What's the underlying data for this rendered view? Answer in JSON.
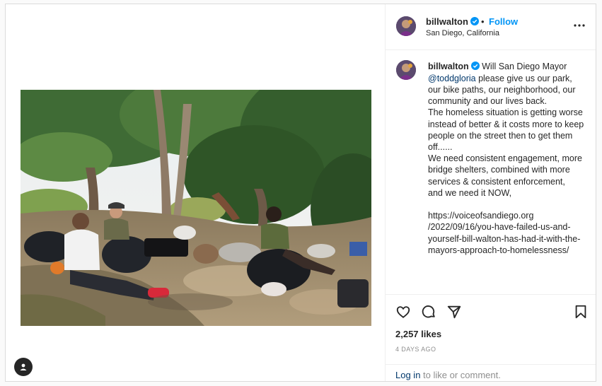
{
  "post": {
    "username": "billwalton",
    "location": "San Diego, California",
    "separator": "•",
    "follow_label": "Follow",
    "caption_username": "billwalton",
    "caption_prefix": " Will San Diego Mayor ",
    "caption_mention": "@toddgloria",
    "caption_body": " please give us our park, our bike paths, our neighborhood, our community and our lives back.\nThe homeless situation is getting worse instead of better & it costs more to keep people on the street then to get them off......\nWe need consistent engagement, more bridge shelters, combined with more services & consistent enforcement,\nand we need it NOW,\n\nhttps://voiceofsandiego.org\n/2022/09/16/you-have-failed-us-and-yourself-bill-walton-has-had-it-with-the-mayors-approach-to-homelessness/",
    "likes": "2,257 likes",
    "date": "4 DAYS AGO",
    "login_link": "Log in",
    "login_suffix": " to like or comment."
  },
  "icons": {
    "more": "more-horizontal-icon",
    "like": "heart-icon",
    "comment": "comment-icon",
    "share": "share-icon",
    "save": "bookmark-icon",
    "verified": "verified-badge-icon",
    "profile": "user-icon"
  },
  "colors": {
    "accent": "#0095f6",
    "link": "#00376b",
    "muted": "#8e8e8e"
  }
}
